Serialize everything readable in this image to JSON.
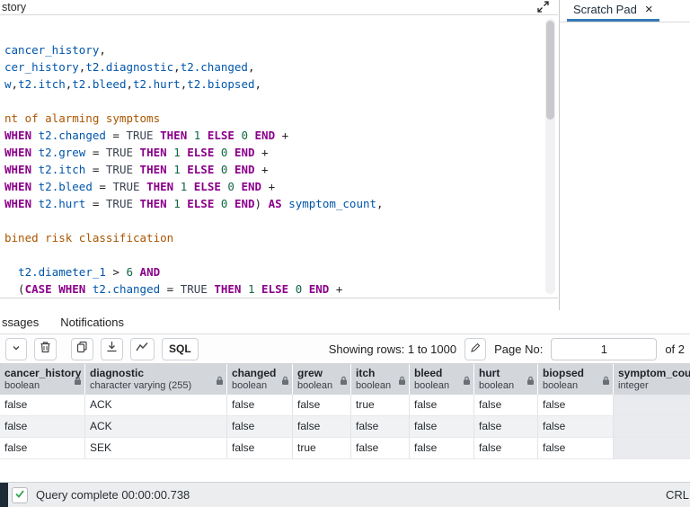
{
  "topbar": {
    "history_tab_partial": "story"
  },
  "scratchpad": {
    "title": "Scratch Pad",
    "close_label": "×"
  },
  "editor": {
    "lines": [
      {
        "segs": [
          [
            "id",
            "cancer_history"
          ],
          [
            "op",
            ","
          ]
        ]
      },
      {
        "segs": [
          [
            "id",
            "cer_history"
          ],
          [
            "op",
            ","
          ],
          [
            "id",
            "t2.diagnostic"
          ],
          [
            "op",
            ","
          ],
          [
            "id",
            "t2.changed"
          ],
          [
            "op",
            ","
          ]
        ]
      },
      {
        "segs": [
          [
            "id",
            "w"
          ],
          [
            "op",
            ","
          ],
          [
            "id",
            "t2.itch"
          ],
          [
            "op",
            ","
          ],
          [
            "id",
            "t2.bleed"
          ],
          [
            "op",
            ","
          ],
          [
            "id",
            "t2.hurt"
          ],
          [
            "op",
            ","
          ],
          [
            "id",
            "t2.biopsed"
          ],
          [
            "op",
            ","
          ]
        ]
      },
      {
        "segs": []
      },
      {
        "segs": [
          [
            "cmt",
            "nt of alarming symptoms"
          ]
        ]
      },
      {
        "segs": [
          [
            "kw",
            "WHEN"
          ],
          [
            "op",
            " "
          ],
          [
            "id",
            "t2.changed"
          ],
          [
            "op",
            " = "
          ],
          [
            "atom",
            "TRUE"
          ],
          [
            "op",
            " "
          ],
          [
            "kw",
            "THEN"
          ],
          [
            "op",
            " "
          ],
          [
            "num",
            "1"
          ],
          [
            "op",
            " "
          ],
          [
            "kw",
            "ELSE"
          ],
          [
            "op",
            " "
          ],
          [
            "num",
            "0"
          ],
          [
            "op",
            " "
          ],
          [
            "kw",
            "END"
          ],
          [
            "op",
            " +"
          ]
        ]
      },
      {
        "segs": [
          [
            "kw",
            "WHEN"
          ],
          [
            "op",
            " "
          ],
          [
            "id",
            "t2.grew"
          ],
          [
            "op",
            " = "
          ],
          [
            "atom",
            "TRUE"
          ],
          [
            "op",
            " "
          ],
          [
            "kw",
            "THEN"
          ],
          [
            "op",
            " "
          ],
          [
            "num",
            "1"
          ],
          [
            "op",
            " "
          ],
          [
            "kw",
            "ELSE"
          ],
          [
            "op",
            " "
          ],
          [
            "num",
            "0"
          ],
          [
            "op",
            " "
          ],
          [
            "kw",
            "END"
          ],
          [
            "op",
            " +"
          ]
        ]
      },
      {
        "segs": [
          [
            "kw",
            "WHEN"
          ],
          [
            "op",
            " "
          ],
          [
            "id",
            "t2.itch"
          ],
          [
            "op",
            " = "
          ],
          [
            "atom",
            "TRUE"
          ],
          [
            "op",
            " "
          ],
          [
            "kw",
            "THEN"
          ],
          [
            "op",
            " "
          ],
          [
            "num",
            "1"
          ],
          [
            "op",
            " "
          ],
          [
            "kw",
            "ELSE"
          ],
          [
            "op",
            " "
          ],
          [
            "num",
            "0"
          ],
          [
            "op",
            " "
          ],
          [
            "kw",
            "END"
          ],
          [
            "op",
            " +"
          ]
        ]
      },
      {
        "segs": [
          [
            "kw",
            "WHEN"
          ],
          [
            "op",
            " "
          ],
          [
            "id",
            "t2.bleed"
          ],
          [
            "op",
            " = "
          ],
          [
            "atom",
            "TRUE"
          ],
          [
            "op",
            " "
          ],
          [
            "kw",
            "THEN"
          ],
          [
            "op",
            " "
          ],
          [
            "num",
            "1"
          ],
          [
            "op",
            " "
          ],
          [
            "kw",
            "ELSE"
          ],
          [
            "op",
            " "
          ],
          [
            "num",
            "0"
          ],
          [
            "op",
            " "
          ],
          [
            "kw",
            "END"
          ],
          [
            "op",
            " +"
          ]
        ]
      },
      {
        "segs": [
          [
            "kw",
            "WHEN"
          ],
          [
            "op",
            " "
          ],
          [
            "id",
            "t2.hurt"
          ],
          [
            "op",
            " = "
          ],
          [
            "atom",
            "TRUE"
          ],
          [
            "op",
            " "
          ],
          [
            "kw",
            "THEN"
          ],
          [
            "op",
            " "
          ],
          [
            "num",
            "1"
          ],
          [
            "op",
            " "
          ],
          [
            "kw",
            "ELSE"
          ],
          [
            "op",
            " "
          ],
          [
            "num",
            "0"
          ],
          [
            "op",
            " "
          ],
          [
            "kw",
            "END"
          ],
          [
            "op",
            ") "
          ],
          [
            "kw",
            "AS"
          ],
          [
            "op",
            " "
          ],
          [
            "id",
            "symptom_count"
          ],
          [
            "op",
            ","
          ]
        ]
      },
      {
        "segs": []
      },
      {
        "segs": [
          [
            "cmt",
            "bined risk classification"
          ]
        ]
      },
      {
        "segs": []
      },
      {
        "segs": [
          [
            "op",
            "  "
          ],
          [
            "id",
            "t2.diameter_1"
          ],
          [
            "op",
            " > "
          ],
          [
            "num",
            "6"
          ],
          [
            "op",
            " "
          ],
          [
            "kw",
            "AND"
          ]
        ]
      },
      {
        "segs": [
          [
            "op",
            "  ("
          ],
          [
            "kw",
            "CASE"
          ],
          [
            "op",
            " "
          ],
          [
            "kw",
            "WHEN"
          ],
          [
            "op",
            " "
          ],
          [
            "id",
            "t2.changed"
          ],
          [
            "op",
            " = "
          ],
          [
            "atom",
            "TRUE"
          ],
          [
            "op",
            " "
          ],
          [
            "kw",
            "THEN"
          ],
          [
            "op",
            " "
          ],
          [
            "num",
            "1"
          ],
          [
            "op",
            " "
          ],
          [
            "kw",
            "ELSE"
          ],
          [
            "op",
            " "
          ],
          [
            "num",
            "0"
          ],
          [
            "op",
            " "
          ],
          [
            "kw",
            "END"
          ],
          [
            "op",
            " +"
          ]
        ]
      }
    ]
  },
  "results": {
    "tabs": [
      {
        "label": "ssages"
      },
      {
        "label": "Notifications"
      }
    ],
    "toolbar": {
      "sql_button": "SQL",
      "showing_rows": "Showing rows: 1 to 1000",
      "page_label": "Page No:",
      "page_value": "1",
      "page_total": "of 2"
    },
    "grid": {
      "columns": [
        {
          "name": "cancer_history",
          "type": "boolean",
          "lock": true
        },
        {
          "name": "diagnostic",
          "type": "character varying (255)",
          "lock": true
        },
        {
          "name": "changed",
          "type": "boolean",
          "lock": true
        },
        {
          "name": "grew",
          "type": "boolean",
          "lock": true
        },
        {
          "name": "itch",
          "type": "boolean",
          "lock": true
        },
        {
          "name": "bleed",
          "type": "boolean",
          "lock": true
        },
        {
          "name": "hurt",
          "type": "boolean",
          "lock": true
        },
        {
          "name": "biopsed",
          "type": "boolean",
          "lock": true
        },
        {
          "name": "symptom_cou",
          "type": "integer",
          "lock": false
        }
      ],
      "rows": [
        [
          "false",
          "ACK",
          "false",
          "false",
          "true",
          "false",
          "false",
          "false",
          ""
        ],
        [
          "false",
          "ACK",
          "false",
          "false",
          "false",
          "false",
          "false",
          "false",
          ""
        ],
        [
          "false",
          "SEK",
          "false",
          "true",
          "false",
          "false",
          "false",
          "false",
          ""
        ]
      ]
    }
  },
  "statusbar": {
    "message": "Query complete 00:00:00.738",
    "right_label": "CRL"
  }
}
